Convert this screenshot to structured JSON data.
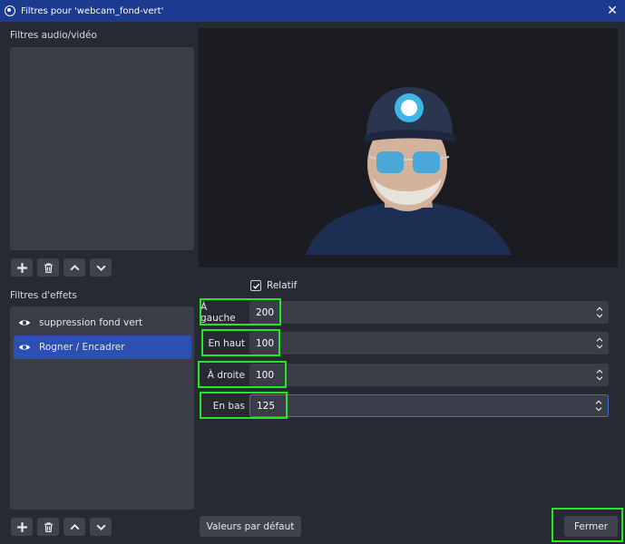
{
  "window": {
    "title": "Filtres pour 'webcam_fond-vert'",
    "close_symbol": "✕"
  },
  "audio_video": {
    "label": "Filtres audio/vidéo"
  },
  "effects": {
    "label": "Filtres d'effets",
    "items": [
      {
        "label": "suppression fond vert",
        "selected": false
      },
      {
        "label": "Rogner / Encadrer",
        "selected": true
      }
    ]
  },
  "relatif": {
    "label": "Relatif",
    "checked": true
  },
  "crop": {
    "left": {
      "label": "À gauche",
      "value": "200"
    },
    "top": {
      "label": "En haut",
      "value": "100"
    },
    "right": {
      "label": "À droite",
      "value": "100"
    },
    "bottom": {
      "label": "En bas",
      "value": "125"
    }
  },
  "buttons": {
    "defaults": "Valeurs par défaut",
    "close": "Fermer"
  },
  "colors": {
    "highlight": "#27e527",
    "selection": "#2b4fb3",
    "titlebar": "#1c3a8f"
  }
}
